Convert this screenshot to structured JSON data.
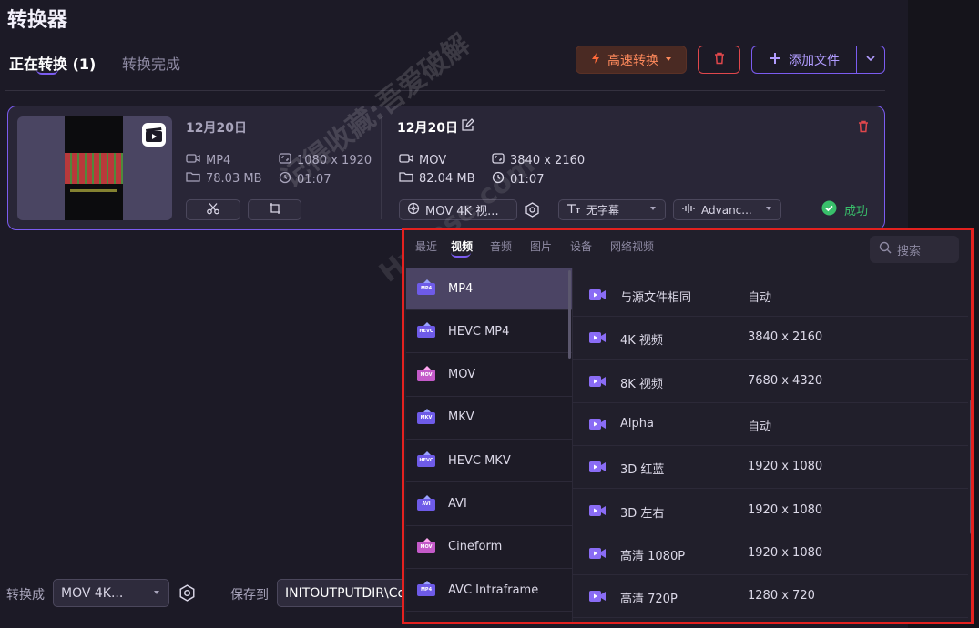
{
  "app": {
    "title": "转换器"
  },
  "tabs": {
    "converting": "正在转换 (1)",
    "completed": "转换完成"
  },
  "toolbar": {
    "fast_convert": "高速转换",
    "add_files": "添加文件"
  },
  "item": {
    "source": {
      "name": "12月20日",
      "format": "MP4",
      "resolution": "1080 x 1920",
      "size": "78.03 MB",
      "duration": "01:07"
    },
    "target": {
      "name": "12月20日",
      "format": "MOV",
      "resolution": "3840 x 2160",
      "size": "82.04 MB",
      "duration": "01:07"
    },
    "format_dropdown": "MOV 4K 视...",
    "subtitle_dropdown": "无字幕",
    "audio_dropdown": "Advanc...",
    "status": "成功"
  },
  "footer": {
    "convert_to_label": "转换成",
    "convert_to_value": "MOV 4K...",
    "save_to_label": "保存到",
    "save_to_value": "INITOUTPUTDIR\\Co"
  },
  "popup": {
    "tabs": [
      "最近",
      "视频",
      "音频",
      "图片",
      "设备",
      "网络视频"
    ],
    "active_tab": "视频",
    "search_placeholder": "搜索",
    "formats": [
      {
        "label": "MP4",
        "icon_text": "MP4",
        "selected": true
      },
      {
        "label": "HEVC MP4",
        "icon_text": "HEVC"
      },
      {
        "label": "MOV",
        "icon_text": "MOV"
      },
      {
        "label": "MKV",
        "icon_text": "MKV"
      },
      {
        "label": "HEVC MKV",
        "icon_text": "HEVC"
      },
      {
        "label": "AVI",
        "icon_text": "AVI"
      },
      {
        "label": "Cineform",
        "icon_text": "MOV"
      },
      {
        "label": "AVC Intraframe",
        "icon_text": "MP4"
      }
    ],
    "presets": [
      {
        "name": "与源文件相同",
        "res": "自动"
      },
      {
        "name": "4K 视频",
        "res": "3840 x 2160"
      },
      {
        "name": "8K 视频",
        "res": "7680 x 4320"
      },
      {
        "name": "Alpha",
        "res": "自动"
      },
      {
        "name": "3D 红蓝",
        "res": "1920 x 1080"
      },
      {
        "name": "3D 左右",
        "res": "1920 x 1080"
      },
      {
        "name": "高清 1080P",
        "res": "1920 x 1080"
      },
      {
        "name": "高清 720P",
        "res": "1280 x 720"
      }
    ]
  },
  "watermark": {
    "line1": "记得收藏:吾爱破解",
    "line2": "HyCase.com"
  },
  "colors": {
    "accent": "#7b5cf0",
    "danger": "#e0474c",
    "success": "#39c06b",
    "highlight_box": "#e3211f"
  }
}
